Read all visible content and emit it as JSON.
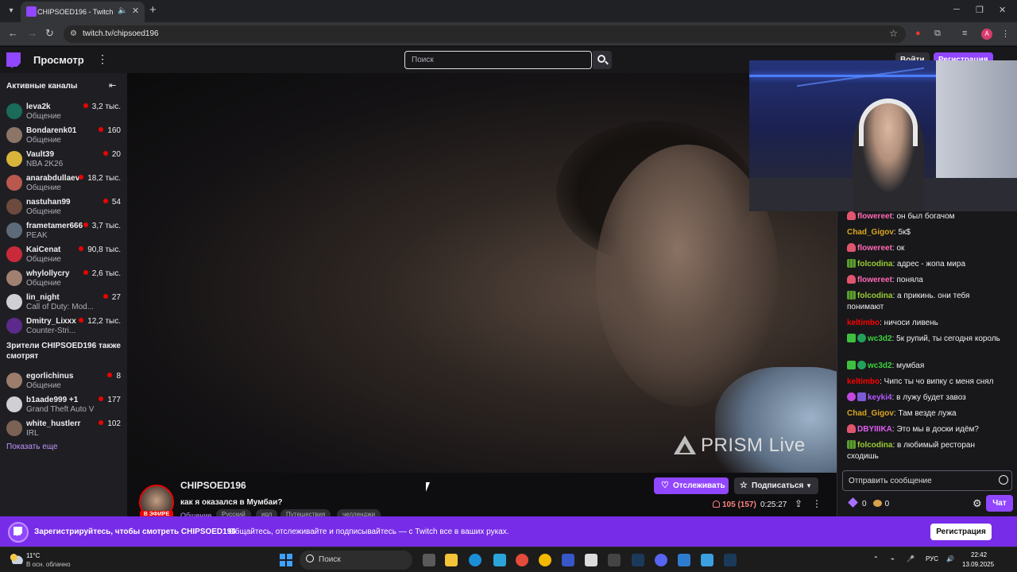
{
  "browser": {
    "tab_title": "CHIPSOED196 - Twitch",
    "url": "twitch.tv/chipsoed196",
    "profile_initial": "A"
  },
  "topnav": {
    "browse_label": "Просмотр",
    "search_placeholder": "Поиск",
    "login_label": "Войти",
    "signup_label": "Регистрация"
  },
  "sidebar": {
    "header": "Активные каналы",
    "channels": [
      {
        "name": "leva2k",
        "game": "Общение",
        "viewers": "3,2 тыс.",
        "avatar_color": "#1a6b5a"
      },
      {
        "name": "Bondarenk01",
        "game": "Общение",
        "viewers": "160",
        "avatar_color": "#8c7466"
      },
      {
        "name": "Vault39",
        "game": "NBA 2K26",
        "viewers": "20",
        "avatar_color": "#d9b43a"
      },
      {
        "name": "anarabdullaev",
        "game": "Общение",
        "viewers": "18,2 тыс.",
        "avatar_color": "#b8584e"
      },
      {
        "name": "nastuhan99",
        "game": "Общение",
        "viewers": "54",
        "avatar_color": "#6e4a3e"
      },
      {
        "name": "frametamer666",
        "game": "PEAK",
        "viewers": "3,7 тыс.",
        "avatar_color": "#5d6a7a"
      },
      {
        "name": "KaiCenat",
        "game": "Общение",
        "viewers": "90,8 тыс.",
        "avatar_color": "#c92a3a"
      },
      {
        "name": "whylollycry",
        "game": "Общение",
        "viewers": "2,6 тыс.",
        "avatar_color": "#a08070"
      },
      {
        "name": "lin_night",
        "game": "Call of Duty: Mod...",
        "viewers": "27",
        "avatar_color": "#cfcfd4"
      },
      {
        "name": "Dmitry_Lixxx",
        "game": "Counter-Stri...",
        "viewers": "12,2 тыс.",
        "avatar_color": "#5b2a8a"
      }
    ],
    "also_watch_header": "Зрители CHIPSOED196 также смотрят",
    "also_watch": [
      {
        "name": "egorlichinus",
        "game": "Общение",
        "viewers": "8",
        "avatar_color": "#9c7d6c"
      },
      {
        "name": "b1aade999 +1",
        "game": "Grand Theft Auto V",
        "viewers": "177",
        "avatar_color": "#d0d0d4"
      },
      {
        "name": "white_hustlerr",
        "game": "IRL",
        "viewers": "102",
        "avatar_color": "#7b6255"
      }
    ],
    "show_more": "Показать еще"
  },
  "video": {
    "watermark": "PRISM Live"
  },
  "chat": {
    "messages": [
      {
        "user": "flowereet",
        "color": "#ff69b4",
        "badges": [
          "heart"
        ],
        "text": ": он был богачом"
      },
      {
        "user": "Chad_Gigov",
        "color": "#daa520",
        "badges": [],
        "text": ": 5к$"
      },
      {
        "user": "flowereet",
        "color": "#ff69b4",
        "badges": [
          "heart"
        ],
        "text": ": ок"
      },
      {
        "user": "folcodina",
        "color": "#9acd32",
        "badges": [
          "bars"
        ],
        "text": ": адрес - жопа мира"
      },
      {
        "user": "flowereet",
        "color": "#ff69b4",
        "badges": [
          "heart"
        ],
        "text": ": поняла"
      },
      {
        "user": "folcodina",
        "color": "#9acd32",
        "badges": [
          "bars"
        ],
        "text": ": а прикинь. они тебя понимают"
      },
      {
        "user": "keltimbo",
        "color": "#ff0000",
        "badges": [],
        "text": ": ничоси ливень"
      },
      {
        "user": "wc3d2",
        "color": "#3cd23c",
        "badges": [
          "check",
          "leaf"
        ],
        "text": ": 5к рупий, ты сегодня король"
      },
      {
        "user": "wc3d2",
        "color": "#3cd23c",
        "badges": [
          "check",
          "leaf"
        ],
        "text": ": мумбая"
      },
      {
        "user": "keltimbo",
        "color": "#ff0000",
        "badges": [],
        "text": ": Чипс ты чо випку с меня снял"
      },
      {
        "user": "keyki4",
        "color": "#b45aff",
        "badges": [
          "purple",
          "pb"
        ],
        "text": ": в лужу будет завоз"
      },
      {
        "user": "Chad_Gigov",
        "color": "#daa520",
        "badges": [],
        "text": ": Там везде лужа"
      },
      {
        "user": "DBYIIIKA",
        "color": "#e05cf0",
        "badges": [
          "heart"
        ],
        "text": ": Это мы в доски идём?"
      },
      {
        "user": "folcodina",
        "color": "#9acd32",
        "badges": [
          "bars"
        ],
        "text": ": в любимый ресторан сходишь"
      }
    ],
    "input_placeholder": "Отправить сообщение",
    "points_gems": "0",
    "points_coins": "0",
    "chat_button": "Чат"
  },
  "stream": {
    "streamer": "CHIPSOED196",
    "live_badge": "В ЭФИРЕ",
    "title": "как я оказался в Мумбаи?",
    "category": "Общение",
    "tags": [
      "Русский",
      "ирл",
      "Путешествия",
      "челленджи"
    ],
    "follow_label": "Отслеживать",
    "subscribe_label": "Подписаться",
    "viewers": "105 (157)",
    "uptime": "0:25:27"
  },
  "banner": {
    "bold_text": "Зарегистрируйтесь, чтобы смотреть CHIPSOED196",
    "text": "Общайтесь, отслеживайте и подписывайтесь — с Twitch все в ваших руках.",
    "button": "Регистрация"
  },
  "taskbar": {
    "weather_temp": "11°C",
    "weather_desc": "В осн. облачно",
    "search_label": "Поиск",
    "lang": "РУС",
    "time": "22:42",
    "date": "13.09.2025"
  }
}
